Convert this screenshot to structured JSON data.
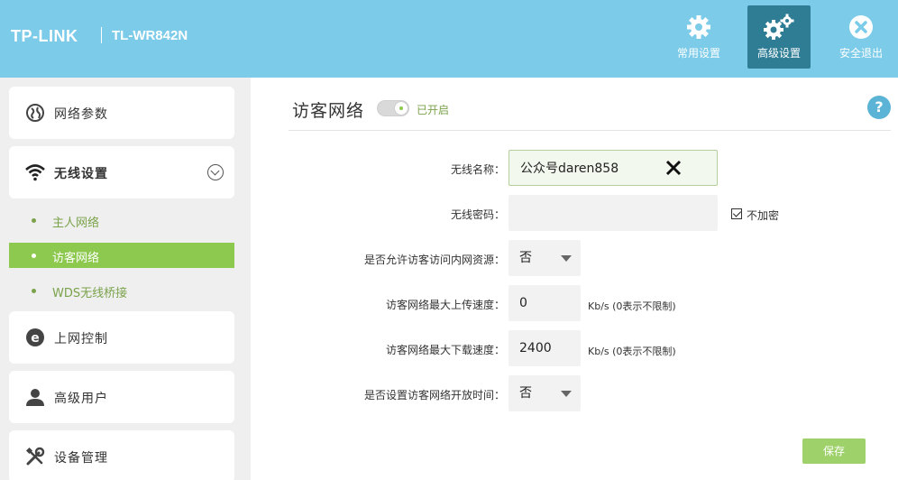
{
  "header": {
    "brand": "TP-LINK",
    "model": "TL-WR842N",
    "buttons": [
      {
        "label": "常用设置",
        "icon": "gear-icon"
      },
      {
        "label": "高级设置",
        "icon": "gears-icon"
      },
      {
        "label": "安全退出",
        "icon": "exit-icon"
      }
    ],
    "accent": "#7ccbe9"
  },
  "sidebar": {
    "items": [
      {
        "label": "网络参数",
        "icon": "network-icon"
      },
      {
        "label": "无线设置",
        "icon": "wifi-icon"
      },
      {
        "label": "上网控制",
        "icon": "internet-icon"
      },
      {
        "label": "高级用户",
        "icon": "user-icon"
      },
      {
        "label": "设备管理",
        "icon": "tools-icon"
      }
    ],
    "subitems": [
      {
        "label": "主人网络"
      },
      {
        "label": "访客网络"
      },
      {
        "label": "WDS无线桥接"
      }
    ]
  },
  "main": {
    "title": "访客网络",
    "status": "已开启",
    "help": "?",
    "fields": {
      "ssid_label": "无线名称：",
      "ssid_value": "公众号daren858",
      "pwd_label": "无线密码：",
      "pwd_value": "",
      "no_encrypt_label": "不加密",
      "lan_access_label": "是否允许访客访问内网资源：",
      "lan_access_value": "否",
      "up_label": "访客网络最大上传速度：",
      "up_value": "0",
      "down_label": "访客网络最大下载速度：",
      "down_value": "2400",
      "unit": "Kb/s (0表示不限制)",
      "schedule_label": "是否设置访客网络开放时间：",
      "schedule_value": "否"
    },
    "save_label": "保存"
  }
}
